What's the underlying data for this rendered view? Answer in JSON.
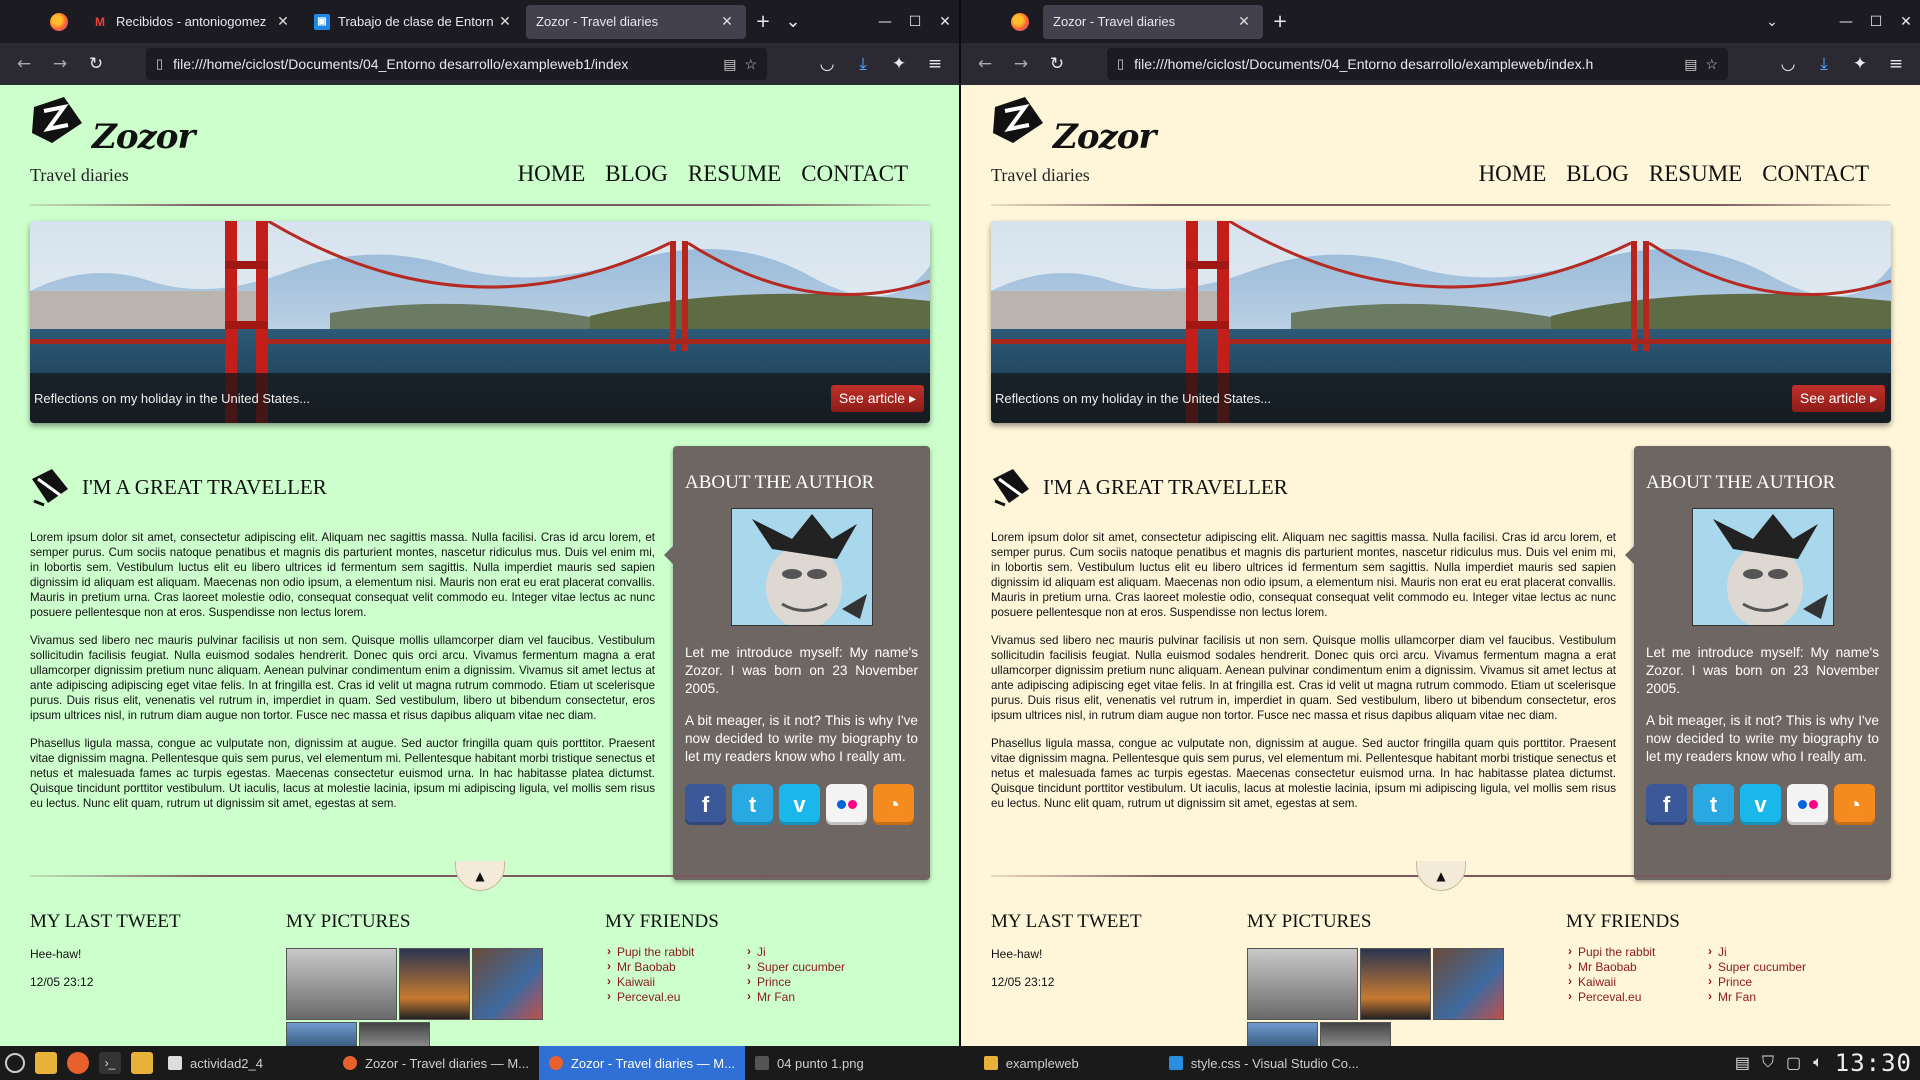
{
  "browser_left": {
    "tabs": [
      {
        "title": "Recibidos - antoniogomez",
        "favicon": "gmail-icon",
        "active": false
      },
      {
        "title": "Trabajo de clase de Entorn",
        "favicon": "classroom-icon",
        "active": false
      },
      {
        "title": "Zozor - Travel diaries",
        "favicon": "",
        "active": true
      }
    ],
    "url": "file:///home/ciclost/Documents/04_Entorno desarrollo/exampleweb1/index"
  },
  "browser_right": {
    "tabs": [
      {
        "title": "Zozor - Travel diaries",
        "favicon": "",
        "active": true
      }
    ],
    "url": "file:///home/ciclost/Documents/04_Entorno desarrollo/exampleweb/index.h"
  },
  "site": {
    "logo_text": "Zozor",
    "tagline": "Travel diaries",
    "menu": [
      "HOME",
      "BLOG",
      "RESUME",
      "CONTACT"
    ],
    "banner_caption": "Reflections on my holiday in the United States...",
    "banner_button": "See article",
    "article_title": "I'M A GREAT TRAVELLER",
    "paragraphs": [
      "Lorem ipsum dolor sit amet, consectetur adipiscing elit. Aliquam nec sagittis massa. Nulla facilisi. Cras id arcu lorem, et semper purus. Cum sociis natoque penatibus et magnis dis parturient montes, nascetur ridiculus mus. Duis vel enim mi, in lobortis sem. Vestibulum luctus elit eu libero ultrices id fermentum sem sagittis. Nulla imperdiet mauris sed sapien dignissim id aliquam est aliquam. Maecenas non odio ipsum, a elementum nisi. Mauris non erat eu erat placerat convallis. Mauris in pretium urna. Cras laoreet molestie odio, consequat consequat velit commodo eu. Integer vitae lectus ac nunc posuere pellentesque non at eros. Suspendisse non lectus lorem.",
      "Vivamus sed libero nec mauris pulvinar facilisis ut non sem. Quisque mollis ullamcorper diam vel faucibus. Vestibulum sollicitudin facilisis feugiat. Nulla euismod sodales hendrerit. Donec quis orci arcu. Vivamus fermentum magna a erat ullamcorper dignissim pretium nunc aliquam. Aenean pulvinar condimentum enim a dignissim. Vivamus sit amet lectus at ante adipiscing adipiscing eget vitae felis. In at fringilla est. Cras id velit ut magna rutrum commodo. Etiam ut scelerisque purus. Duis risus elit, venenatis vel rutrum in, imperdiet in quam. Sed vestibulum, libero ut bibendum consectetur, eros ipsum ultrices nisl, in rutrum diam augue non tortor. Fusce nec massa et risus dapibus aliquam vitae nec diam.",
      "Phasellus ligula massa, congue ac vulputate non, dignissim at augue. Sed auctor fringilla quam quis porttitor. Praesent vitae dignissim magna. Pellentesque quis sem purus, vel elementum mi. Pellentesque habitant morbi tristique senectus et netus et malesuada fames ac turpis egestas. Maecenas consectetur euismod urna. In hac habitasse platea dictumst. Quisque tincidunt porttitor vestibulum. Ut iaculis, lacus at molestie lacinia, ipsum mi adipiscing ligula, vel mollis sem risus eu lectus. Nunc elit quam, rutrum ut dignissim sit amet, egestas at sem."
    ],
    "author": {
      "title": "ABOUT THE AUTHOR",
      "bio1": "Let me introduce myself: My name's Zozor. I was born on 23 November 2005.",
      "bio2": "A bit meager, is it not? This is why I've now decided to write my biography to let my readers know who I really am.",
      "socials": [
        "facebook-icon",
        "twitter-icon",
        "vimeo-icon",
        "flickr-icon",
        "rss-icon"
      ]
    },
    "tweet_title": "MY LAST TWEET",
    "tweet_text": "Hee-haw!",
    "tweet_date": "12/05 23:12",
    "pictures_title": "MY PICTURES",
    "friends_title": "MY FRIENDS",
    "friends": [
      "Pupi the rabbit",
      "Ji",
      "Mr Baobab",
      "Super cucumber",
      "Kaiwaii",
      "Prince",
      "Perceval.eu",
      "Mr Fan"
    ]
  },
  "colors": {
    "left_page_bg": "#ccffcc",
    "right_page_bg": "#fff6d9",
    "author_box": "#6e6662",
    "friend_link": "#8b1a1a"
  },
  "taskbar": {
    "items": [
      {
        "label": "actividad2_4",
        "active": false
      },
      {
        "label": "Zozor - Travel diaries — M...",
        "active": false
      },
      {
        "label": "Zozor - Travel diaries — M...",
        "active": true
      },
      {
        "label": "04 punto 1.png",
        "active": false
      },
      {
        "label": "exampleweb",
        "active": false
      },
      {
        "label": "style.css - Visual Studio Co...",
        "active": false
      }
    ],
    "clock": "13:30"
  }
}
